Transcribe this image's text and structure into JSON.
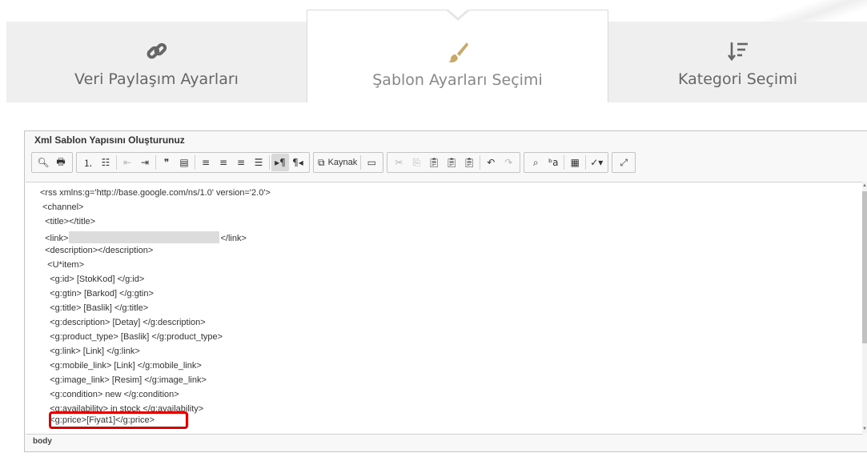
{
  "tabs": [
    {
      "label": "Veri Paylaşım Ayarları",
      "icon": "link-icon",
      "active": false
    },
    {
      "label": "Şablon Ayarları Seçimi",
      "icon": "brush-icon",
      "active": true
    },
    {
      "label": "Kategori Seçimi",
      "icon": "sort-icon",
      "active": false
    }
  ],
  "editor": {
    "title": "Xml Sablon Yapısını Oluşturunuz",
    "source_label": "Kaynak",
    "status_path": "body",
    "lines": [
      "<rss xmlns:g='http://base.google.com/ns/1.0' version='2.0'>",
      " <channel>",
      "  <title></title>",
      "  <link>",
      "  <description></description>",
      "   <U*item>",
      "    <g:id> [StokKod] </g:id>",
      "    <g:gtin> [Barkod] </g:gtin>",
      "    <g:title> [Baslik] </g:title>",
      "    <g:description> [Detay] </g:description>",
      "    <g:product_type> [Baslik] </g:product_type>",
      "    <g:link> [Link] </g:link>",
      "    <g:mobile_link> [Link] </g:mobile_link>",
      "    <g:image_link> [Resim] </g:image_link>",
      "    <g:condition> new </g:condition>",
      "    <g:availability> in stock </g:availability>",
      "    <g:price>[Fiyat1]</g:price>"
    ],
    "link_close": "</link>"
  },
  "colors": {
    "highlight": "#e00000",
    "tab_bg": "#efefef",
    "brush": "#c8a96a"
  }
}
